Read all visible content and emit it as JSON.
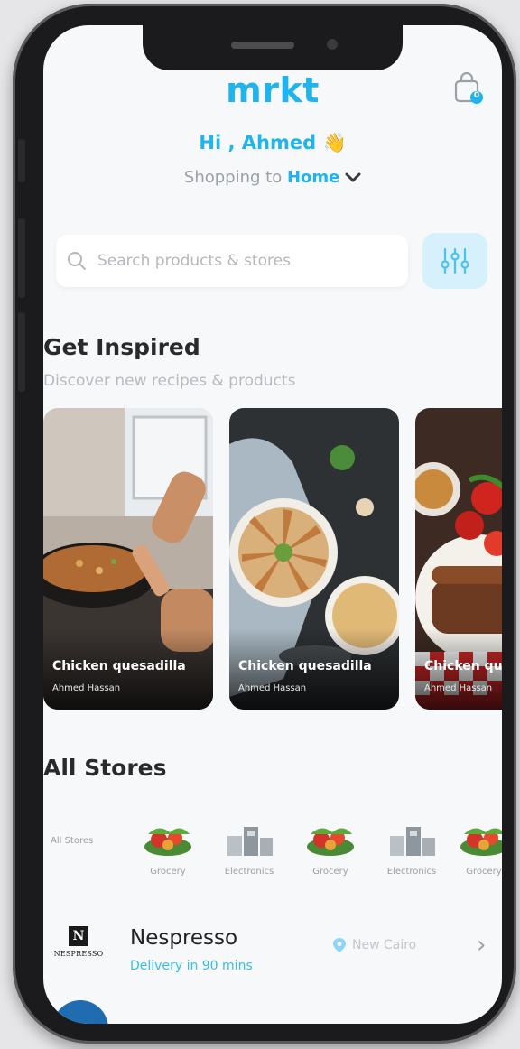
{
  "app": {
    "logo": "mrkt"
  },
  "header": {
    "greeting": "Hi , Ahmed",
    "wave_emoji": "👋",
    "shipping_prefix": "Shopping to",
    "shipping_location": "Home",
    "cart_icon": "shopping-bag-icon",
    "cart_count": "0"
  },
  "search": {
    "placeholder": "Search products & stores",
    "icon": "search-icon",
    "filter_icon": "filter-sliders-icon"
  },
  "inspired": {
    "title": "Get Inspired",
    "subtitle": "Discover new recipes & products",
    "cards": [
      {
        "title": "Chicken quesadilla",
        "author": "Ahmed Hassan"
      },
      {
        "title": "Chicken quesadilla",
        "author": "Ahmed Hassan"
      },
      {
        "title": "Chicken quesadilla",
        "author": "Ahmed Hassan"
      }
    ]
  },
  "stores": {
    "title": "All Stores",
    "all_label": "All Stores",
    "categories": [
      "Grocery",
      "Electronics",
      "Grocery",
      "Electronics",
      "Grocery"
    ]
  },
  "store_list": [
    {
      "name": "Nespresso",
      "logo_text": "NESPRESSO",
      "logo_letter": "N",
      "delivery": "Delivery in 90 mins",
      "location": "New Cairo"
    }
  ],
  "colors": {
    "accent": "#1fb5ec",
    "background": "#f7f8fa"
  }
}
